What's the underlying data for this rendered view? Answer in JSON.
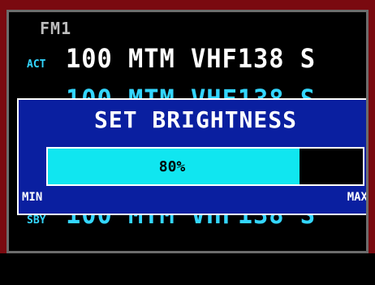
{
  "device": {
    "title": "FM1"
  },
  "rows": {
    "act": {
      "label": "ACT",
      "value": "100  MTM VHF138 S"
    },
    "partial": {
      "value": "100  MTM VHF138 S"
    },
    "sby": {
      "label": "SBY",
      "value": "100  MTM VHF138 S"
    }
  },
  "brightness_dialog": {
    "title": "SET BRIGHTNESS",
    "level_text": "80%",
    "level_fraction": 0.8,
    "min_label": "MIN",
    "max_label": "MAX"
  },
  "colors": {
    "frame": "#7a0a10",
    "dialog_bg": "#0a1fa0",
    "bar_fill": "#10e6f0",
    "cyan_text": "#33d6ff"
  }
}
